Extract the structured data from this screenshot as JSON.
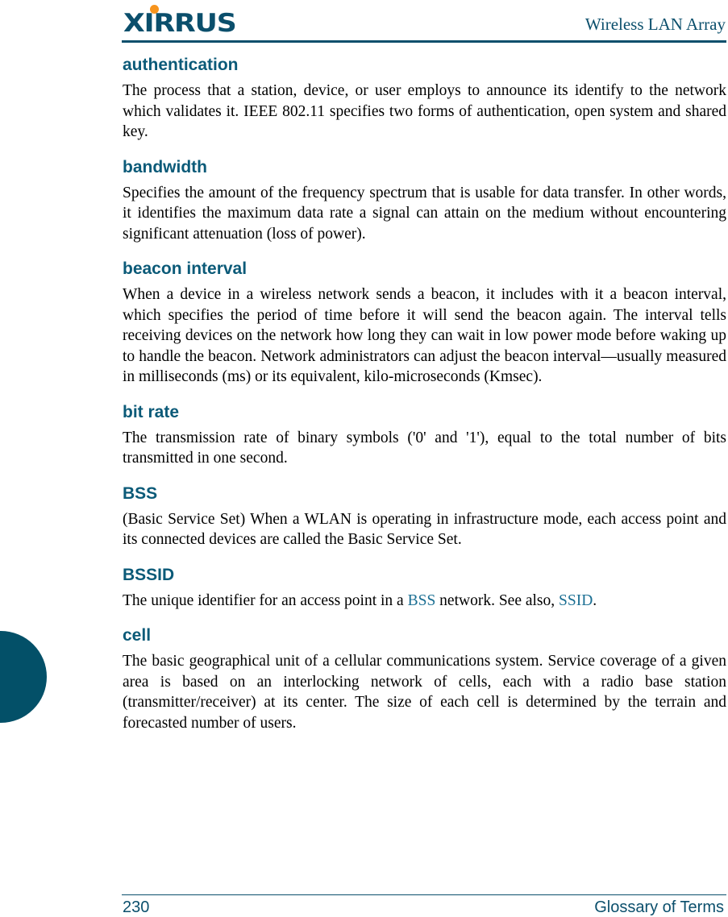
{
  "header": {
    "logo_text": "XIRRUS",
    "running_title": "Wireless LAN Array"
  },
  "colors": {
    "brand_teal": "#0b4f6c",
    "logo_dot_orange": "#f7941d",
    "term_heading": "#0b5a78",
    "cross_reference": "#1b6f93"
  },
  "entries": [
    {
      "term": "authentication",
      "definition": "The process that a station, device, or user employs to announce its identify to the network which validates it. IEEE 802.11 specifies two forms of authentication, open system and shared key."
    },
    {
      "term": "bandwidth",
      "definition": "Specifies the amount of the frequency spectrum that is usable for data transfer. In other words, it identifies the maximum data rate a signal can attain on the medium without encountering significant attenuation (loss of power)."
    },
    {
      "term": "beacon interval",
      "definition": "When a device in a wireless network sends a beacon, it includes with it a beacon interval, which specifies the period of time before it will send the beacon again. The interval tells receiving devices on the network how long they can wait in low power mode before waking up to handle the beacon. Network administrators can adjust the beacon interval—usually measured in milliseconds (ms) or its equivalent, kilo-microseconds (Kmsec)."
    },
    {
      "term": "bit rate",
      "definition": "The transmission rate of binary symbols ('0' and '1'), equal to the total number of bits transmitted in one second."
    },
    {
      "term": "BSS",
      "definition": "(Basic Service Set) When a WLAN is operating in infrastructure mode, each access point and its connected devices are called the Basic Service Set."
    },
    {
      "term": "BSSID",
      "definition_parts": {
        "before": "The unique identifier for an access point in a ",
        "link1": "BSS",
        "middle": " network. See also, ",
        "link2": "SSID",
        "after": "."
      }
    },
    {
      "term": "cell",
      "definition": "The basic geographical unit of a cellular communications system. Service coverage of a given area is based on an interlocking network of cells, each with a radio base station (transmitter/receiver) at its center. The size of each cell is determined by the terrain and forecasted number of users."
    }
  ],
  "footer": {
    "page_number": "230",
    "section_title": "Glossary of Terms"
  }
}
